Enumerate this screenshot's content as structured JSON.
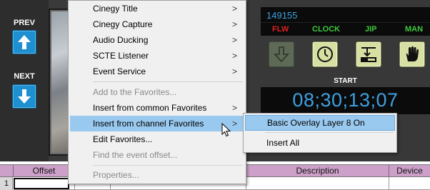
{
  "left_panel": {
    "prev_label": "PREV",
    "next_label": "NEXT"
  },
  "right_panel": {
    "event_id": "149155",
    "statuses": [
      {
        "label": "FLW",
        "color": "#e02020"
      },
      {
        "label": "CLOCK",
        "color": "#3ccc3c"
      },
      {
        "label": "JIP",
        "color": "#3ccc3c"
      },
      {
        "label": "MAN",
        "color": "#3ccc3c"
      }
    ],
    "controls": [
      {
        "icon": "down-arrow-icon",
        "state": "dim"
      },
      {
        "icon": "clock-icon",
        "state": "lit"
      },
      {
        "icon": "jip-insert-icon",
        "state": "lit"
      },
      {
        "icon": "hand-icon",
        "state": "lit"
      }
    ],
    "start_label": "START",
    "timecode": "08;30;13;07"
  },
  "context_menu": {
    "items": [
      {
        "label": "Cinegy Title",
        "submenu": true,
        "disabled": false
      },
      {
        "label": "Cinegy Capture",
        "submenu": true,
        "disabled": false
      },
      {
        "label": "Audio Ducking",
        "submenu": true,
        "disabled": false
      },
      {
        "label": "SCTE Listener",
        "submenu": true,
        "disabled": false
      },
      {
        "label": "Event Service",
        "submenu": true,
        "disabled": false
      },
      {
        "label": "Add to the Favorites...",
        "submenu": false,
        "disabled": true
      },
      {
        "label": "Insert from common Favorites",
        "submenu": true,
        "disabled": false
      },
      {
        "label": "Insert from channel Favorites",
        "submenu": true,
        "disabled": false,
        "highlighted": true
      },
      {
        "label": "Edit Favorites...",
        "submenu": false,
        "disabled": false
      },
      {
        "label": "Find the event offset...",
        "submenu": false,
        "disabled": true
      },
      {
        "label": "Properties...",
        "submenu": false,
        "disabled": true
      }
    ],
    "arrow_glyph": ">"
  },
  "submenu": {
    "items": [
      {
        "label": "Basic Overlay Layer 8 On",
        "highlighted": true
      },
      {
        "label": "Insert All",
        "highlighted": false
      }
    ]
  },
  "grid": {
    "columns": [
      "Offset",
      "",
      "",
      "Description",
      "Device"
    ],
    "row_number": "1"
  }
}
